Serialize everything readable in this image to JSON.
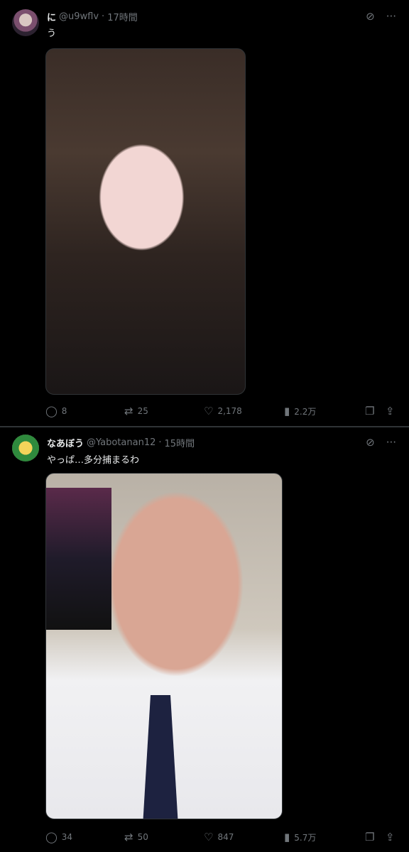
{
  "posts": [
    {
      "name": "に",
      "handle": "@u9wflv",
      "dot": "·",
      "time": "17時間",
      "text": "う",
      "icons": {
        "grok": "grok-icon",
        "more": "more-icon"
      },
      "actions": {
        "replies": "8",
        "reposts": "25",
        "likes": "2,178",
        "views": "2.2万"
      }
    },
    {
      "name": "なあぼう",
      "handle": "@Yabotanan12",
      "dot": "·",
      "time": "15時間",
      "text": "やっぱ…多分捕まるわ",
      "icons": {
        "grok": "grok-icon",
        "more": "more-icon"
      },
      "actions": {
        "replies": "34",
        "reposts": "50",
        "likes": "847",
        "views": "5.7万"
      }
    }
  ],
  "colors": {
    "background": "#000000",
    "text": "#e7e9ea",
    "muted": "#71767b",
    "divider": "#2f3336"
  }
}
